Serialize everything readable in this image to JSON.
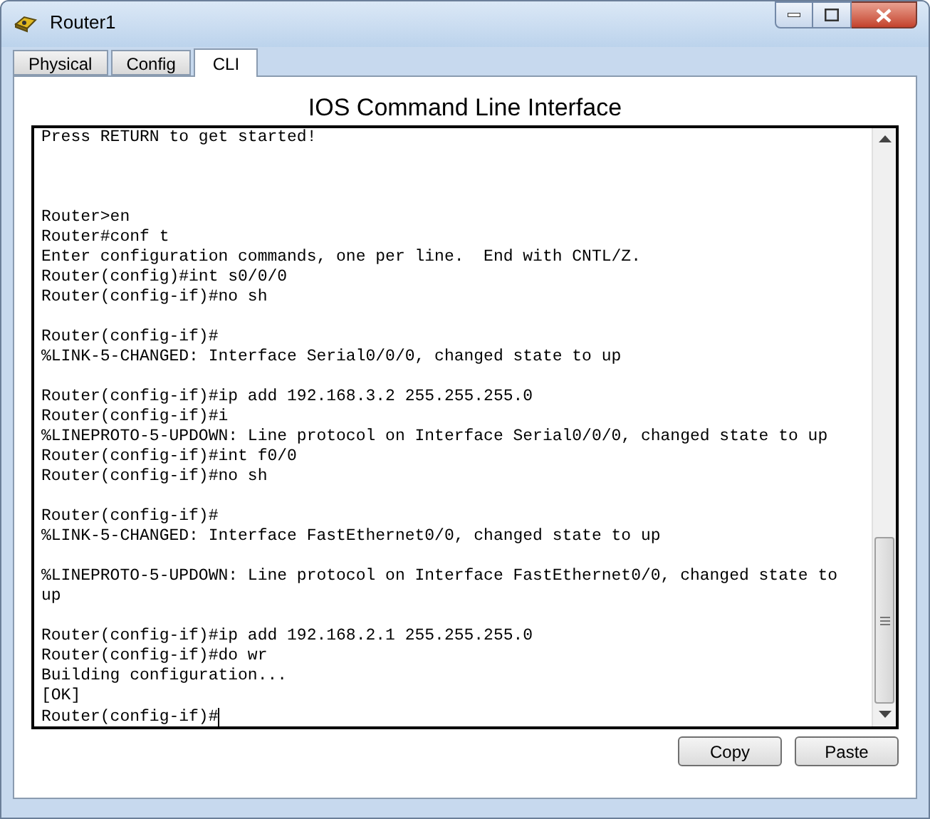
{
  "window": {
    "title": "Router1"
  },
  "tabs": [
    {
      "label": "Physical",
      "selected": false
    },
    {
      "label": "Config",
      "selected": false
    },
    {
      "label": "CLI",
      "selected": true
    }
  ],
  "heading": "IOS Command Line Interface",
  "terminal": {
    "lines": [
      {
        "kind": "text",
        "text": "Press RETURN to get started!"
      },
      {
        "kind": "blank"
      },
      {
        "kind": "blank"
      },
      {
        "kind": "blank"
      },
      {
        "kind": "text",
        "text": "Router>en"
      },
      {
        "kind": "text",
        "text": "Router#conf t"
      },
      {
        "kind": "text",
        "text": "Enter configuration commands, one per line.  End with CNTL/Z."
      },
      {
        "kind": "text",
        "text": "Router(config)#int s0/0/0"
      },
      {
        "kind": "text",
        "text": "Router(config-if)#no sh"
      },
      {
        "kind": "blank"
      },
      {
        "kind": "text",
        "text": "Router(config-if)#"
      },
      {
        "kind": "text",
        "text": "%LINK-5-CHANGED: Interface Serial0/0/0, changed state to up"
      },
      {
        "kind": "blank"
      },
      {
        "kind": "text",
        "text": "Router(config-if)#ip add 192.168.3.2 255.255.255.0"
      },
      {
        "kind": "text",
        "text": "Router(config-if)#i"
      },
      {
        "kind": "text",
        "text": "%LINEPROTO-5-UPDOWN: Line protocol on Interface Serial0/0/0, changed state to up"
      },
      {
        "kind": "text",
        "text": "Router(config-if)#int f0/0"
      },
      {
        "kind": "text",
        "text": "Router(config-if)#no sh"
      },
      {
        "kind": "blank"
      },
      {
        "kind": "text",
        "text": "Router(config-if)#"
      },
      {
        "kind": "text",
        "text": "%LINK-5-CHANGED: Interface FastEthernet0/0, changed state to up"
      },
      {
        "kind": "blank"
      },
      {
        "kind": "text",
        "text": "%LINEPROTO-5-UPDOWN: Line protocol on Interface FastEthernet0/0, changed state to up"
      },
      {
        "kind": "blank"
      },
      {
        "kind": "text",
        "text": "Router(config-if)#ip add 192.168.2.1 255.255.255.0"
      },
      {
        "kind": "text",
        "text": "Router(config-if)#do wr"
      },
      {
        "kind": "text",
        "text": "Building configuration..."
      },
      {
        "kind": "text",
        "text": "[OK]"
      },
      {
        "kind": "prompt",
        "text": "Router(config-if)#"
      }
    ]
  },
  "buttons": [
    "Copy",
    "Paste"
  ]
}
